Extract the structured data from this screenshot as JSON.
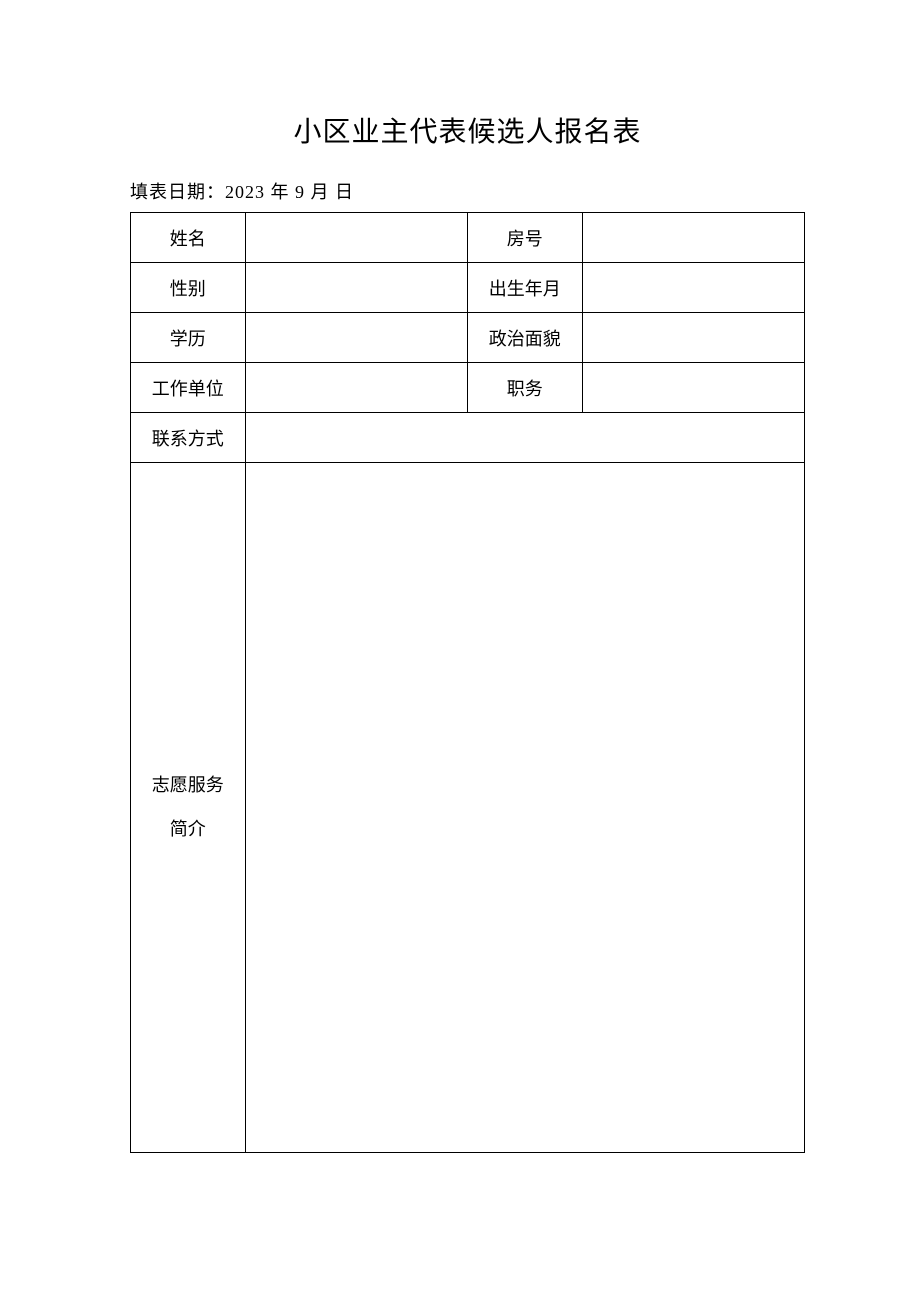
{
  "title": "小区业主代表候选人报名表",
  "date_prefix": "填表日期：",
  "date_value": "2023 年 9 月 日",
  "fields": {
    "name_label": "姓名",
    "name_value": "",
    "room_label": "房号",
    "room_value": "",
    "gender_label": "性别",
    "gender_value": "",
    "birth_label": "出生年月",
    "birth_value": "",
    "education_label": "学历",
    "education_value": "",
    "political_label": "政治面貌",
    "political_value": "",
    "employer_label": "工作单位",
    "employer_value": "",
    "position_label": "职务",
    "position_value": "",
    "contact_label": "联系方式",
    "contact_value": "",
    "intro_label_line1": "志愿服务",
    "intro_label_line2": "简介",
    "intro_value": ""
  }
}
